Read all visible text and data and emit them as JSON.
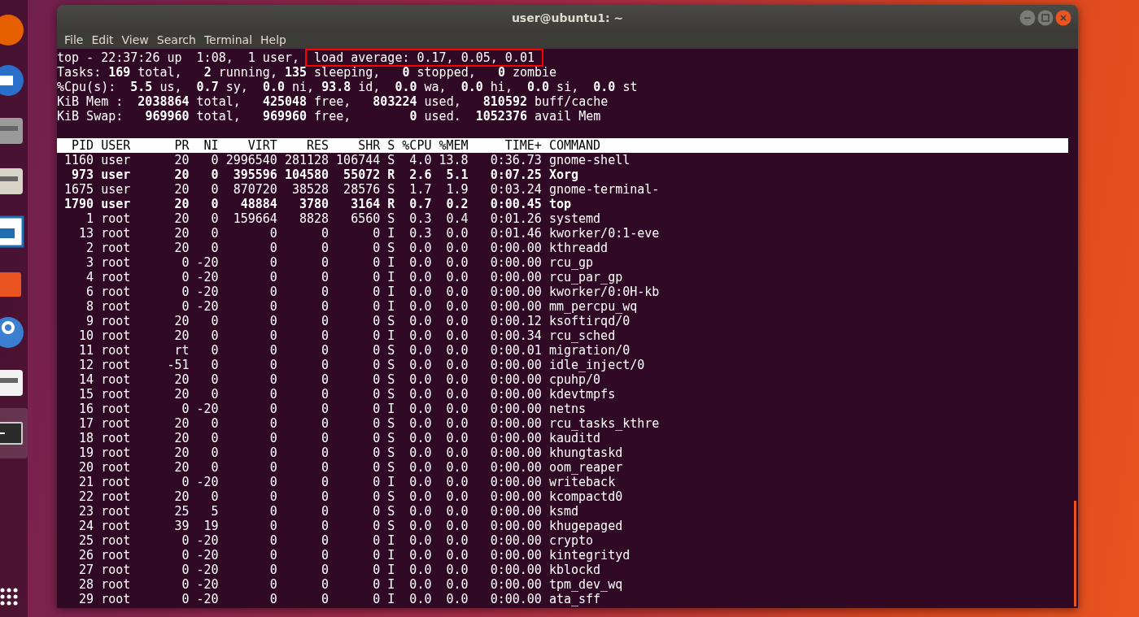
{
  "window": {
    "title": "user@ubuntu1: ~"
  },
  "menu": [
    "File",
    "Edit",
    "View",
    "Search",
    "Terminal",
    "Help"
  ],
  "dock": [
    {
      "kind": "firefox",
      "selected": false
    },
    {
      "kind": "mail",
      "selected": false
    },
    {
      "kind": "files",
      "selected": false
    },
    {
      "kind": "music",
      "selected": false
    },
    {
      "kind": "writer",
      "selected": false
    },
    {
      "kind": "software",
      "selected": false
    },
    {
      "kind": "help",
      "selected": false
    },
    {
      "kind": "amazon",
      "selected": false
    },
    {
      "kind": "terminal",
      "selected": true
    }
  ],
  "summary_lines": [
    {
      "segments": [
        {
          "text": "top - 22:37:26 up  1:08,  1 user,",
          "highlighted": false
        },
        {
          "text": "load average: 0.17, 0.05, 0.01",
          "highlighted": true
        }
      ]
    },
    {
      "segments": [
        {
          "text": "Tasks: **169** total,   **2** running, **135** sleeping,   **0** stopped,   **0** zombie",
          "highlighted": false
        }
      ]
    },
    {
      "segments": [
        {
          "text": "%Cpu(s):  **5.5** us,  **0.7** sy,  **0.0** ni, **93.8** id,  **0.0** wa,  **0.0** hi,  **0.0** si,  **0.0** st",
          "highlighted": false
        }
      ]
    },
    {
      "segments": [
        {
          "text": "KiB Mem :  **2038864** total,   **425048** free,   **803224** used,   **810592** buff/cache",
          "highlighted": false
        }
      ]
    },
    {
      "segments": [
        {
          "text": "KiB Swap:   **969960** total,   **969960** free,        **0** used.  **1052376** avail Mem",
          "highlighted": false
        }
      ]
    }
  ],
  "table": {
    "columns": [
      "PID",
      "USER",
      "PR",
      "NI",
      "VIRT",
      "RES",
      "SHR",
      "S",
      "%CPU",
      "%MEM",
      "TIME+",
      "COMMAND"
    ],
    "rows": [
      {
        "bold": false,
        "cells": [
          "1160",
          "user",
          "20",
          "0",
          "2996540",
          "281128",
          "106744",
          "S",
          "4.0",
          "13.8",
          "0:36.73",
          "gnome-shell"
        ]
      },
      {
        "bold": true,
        "cells": [
          "973",
          "user",
          "20",
          "0",
          "395596",
          "104580",
          "55072",
          "R",
          "2.6",
          "5.1",
          "0:07.25",
          "Xorg"
        ]
      },
      {
        "bold": false,
        "cells": [
          "1675",
          "user",
          "20",
          "0",
          "870720",
          "38528",
          "28576",
          "S",
          "1.7",
          "1.9",
          "0:03.24",
          "gnome-terminal-"
        ]
      },
      {
        "bold": true,
        "cells": [
          "1790",
          "user",
          "20",
          "0",
          "48884",
          "3780",
          "3164",
          "R",
          "0.7",
          "0.2",
          "0:00.45",
          "top"
        ]
      },
      {
        "bold": false,
        "cells": [
          "1",
          "root",
          "20",
          "0",
          "159664",
          "8828",
          "6560",
          "S",
          "0.3",
          "0.4",
          "0:01.26",
          "systemd"
        ]
      },
      {
        "bold": false,
        "cells": [
          "13",
          "root",
          "20",
          "0",
          "0",
          "0",
          "0",
          "I",
          "0.3",
          "0.0",
          "0:01.46",
          "kworker/0:1-eve"
        ]
      },
      {
        "bold": false,
        "cells": [
          "2",
          "root",
          "20",
          "0",
          "0",
          "0",
          "0",
          "S",
          "0.0",
          "0.0",
          "0:00.00",
          "kthreadd"
        ]
      },
      {
        "bold": false,
        "cells": [
          "3",
          "root",
          "0",
          "-20",
          "0",
          "0",
          "0",
          "I",
          "0.0",
          "0.0",
          "0:00.00",
          "rcu_gp"
        ]
      },
      {
        "bold": false,
        "cells": [
          "4",
          "root",
          "0",
          "-20",
          "0",
          "0",
          "0",
          "I",
          "0.0",
          "0.0",
          "0:00.00",
          "rcu_par_gp"
        ]
      },
      {
        "bold": false,
        "cells": [
          "6",
          "root",
          "0",
          "-20",
          "0",
          "0",
          "0",
          "I",
          "0.0",
          "0.0",
          "0:00.00",
          "kworker/0:0H-kb"
        ]
      },
      {
        "bold": false,
        "cells": [
          "8",
          "root",
          "0",
          "-20",
          "0",
          "0",
          "0",
          "I",
          "0.0",
          "0.0",
          "0:00.00",
          "mm_percpu_wq"
        ]
      },
      {
        "bold": false,
        "cells": [
          "9",
          "root",
          "20",
          "0",
          "0",
          "0",
          "0",
          "S",
          "0.0",
          "0.0",
          "0:00.12",
          "ksoftirqd/0"
        ]
      },
      {
        "bold": false,
        "cells": [
          "10",
          "root",
          "20",
          "0",
          "0",
          "0",
          "0",
          "I",
          "0.0",
          "0.0",
          "0:00.34",
          "rcu_sched"
        ]
      },
      {
        "bold": false,
        "cells": [
          "11",
          "root",
          "rt",
          "0",
          "0",
          "0",
          "0",
          "S",
          "0.0",
          "0.0",
          "0:00.01",
          "migration/0"
        ]
      },
      {
        "bold": false,
        "cells": [
          "12",
          "root",
          "-51",
          "0",
          "0",
          "0",
          "0",
          "S",
          "0.0",
          "0.0",
          "0:00.00",
          "idle_inject/0"
        ]
      },
      {
        "bold": false,
        "cells": [
          "14",
          "root",
          "20",
          "0",
          "0",
          "0",
          "0",
          "S",
          "0.0",
          "0.0",
          "0:00.00",
          "cpuhp/0"
        ]
      },
      {
        "bold": false,
        "cells": [
          "15",
          "root",
          "20",
          "0",
          "0",
          "0",
          "0",
          "S",
          "0.0",
          "0.0",
          "0:00.00",
          "kdevtmpfs"
        ]
      },
      {
        "bold": false,
        "cells": [
          "16",
          "root",
          "0",
          "-20",
          "0",
          "0",
          "0",
          "I",
          "0.0",
          "0.0",
          "0:00.00",
          "netns"
        ]
      },
      {
        "bold": false,
        "cells": [
          "17",
          "root",
          "20",
          "0",
          "0",
          "0",
          "0",
          "S",
          "0.0",
          "0.0",
          "0:00.00",
          "rcu_tasks_kthre"
        ]
      },
      {
        "bold": false,
        "cells": [
          "18",
          "root",
          "20",
          "0",
          "0",
          "0",
          "0",
          "S",
          "0.0",
          "0.0",
          "0:00.00",
          "kauditd"
        ]
      },
      {
        "bold": false,
        "cells": [
          "19",
          "root",
          "20",
          "0",
          "0",
          "0",
          "0",
          "S",
          "0.0",
          "0.0",
          "0:00.00",
          "khungtaskd"
        ]
      },
      {
        "bold": false,
        "cells": [
          "20",
          "root",
          "20",
          "0",
          "0",
          "0",
          "0",
          "S",
          "0.0",
          "0.0",
          "0:00.00",
          "oom_reaper"
        ]
      },
      {
        "bold": false,
        "cells": [
          "21",
          "root",
          "0",
          "-20",
          "0",
          "0",
          "0",
          "I",
          "0.0",
          "0.0",
          "0:00.00",
          "writeback"
        ]
      },
      {
        "bold": false,
        "cells": [
          "22",
          "root",
          "20",
          "0",
          "0",
          "0",
          "0",
          "S",
          "0.0",
          "0.0",
          "0:00.00",
          "kcompactd0"
        ]
      },
      {
        "bold": false,
        "cells": [
          "23",
          "root",
          "25",
          "5",
          "0",
          "0",
          "0",
          "S",
          "0.0",
          "0.0",
          "0:00.00",
          "ksmd"
        ]
      },
      {
        "bold": false,
        "cells": [
          "24",
          "root",
          "39",
          "19",
          "0",
          "0",
          "0",
          "S",
          "0.0",
          "0.0",
          "0:00.00",
          "khugepaged"
        ]
      },
      {
        "bold": false,
        "cells": [
          "25",
          "root",
          "0",
          "-20",
          "0",
          "0",
          "0",
          "I",
          "0.0",
          "0.0",
          "0:00.00",
          "crypto"
        ]
      },
      {
        "bold": false,
        "cells": [
          "26",
          "root",
          "0",
          "-20",
          "0",
          "0",
          "0",
          "I",
          "0.0",
          "0.0",
          "0:00.00",
          "kintegrityd"
        ]
      },
      {
        "bold": false,
        "cells": [
          "27",
          "root",
          "0",
          "-20",
          "0",
          "0",
          "0",
          "I",
          "0.0",
          "0.0",
          "0:00.00",
          "kblockd"
        ]
      },
      {
        "bold": false,
        "cells": [
          "28",
          "root",
          "0",
          "-20",
          "0",
          "0",
          "0",
          "I",
          "0.0",
          "0.0",
          "0:00.00",
          "tpm_dev_wq"
        ]
      },
      {
        "bold": false,
        "cells": [
          "29",
          "root",
          "0",
          "-20",
          "0",
          "0",
          "0",
          "I",
          "0.0",
          "0.0",
          "0:00.00",
          "ata_sff"
        ]
      }
    ]
  }
}
